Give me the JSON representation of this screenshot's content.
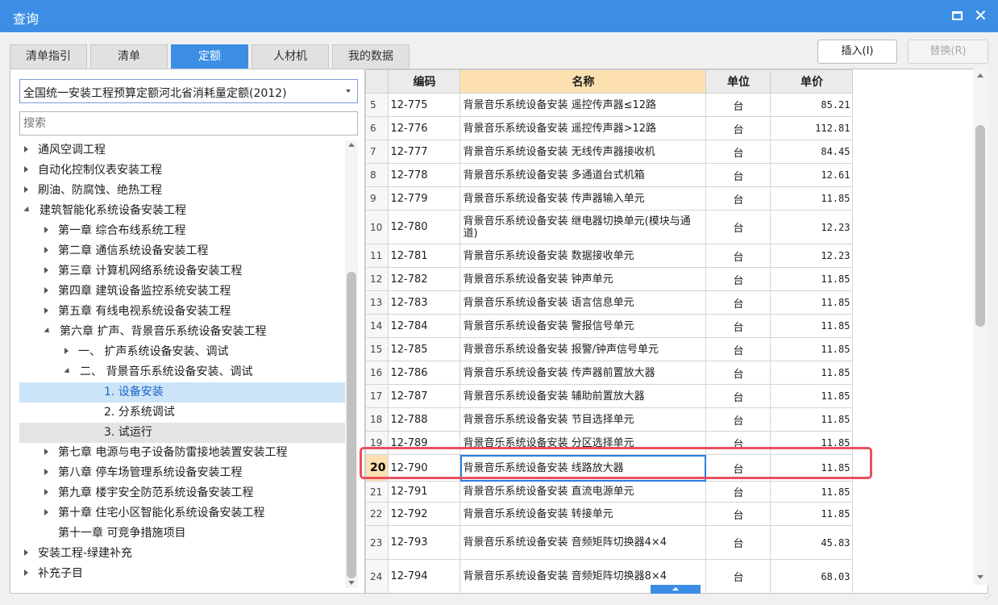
{
  "window": {
    "title": "查询"
  },
  "tabs": [
    "清单指引",
    "清单",
    "定额",
    "人材机",
    "我的数据"
  ],
  "buttons": {
    "insert": "插入(I)",
    "replace": "替换(R)"
  },
  "left": {
    "dropdown_value": "全国统一安装工程预算定额河北省消耗量定额(2012)",
    "search_placeholder": "搜索",
    "tree": [
      "通风空调工程",
      "自动化控制仪表安装工程",
      "刷油、防腐蚀、绝热工程",
      "建筑智能化系统设备安装工程",
      "第一章 综合布线系统工程",
      "第二章 通信系统设备安装工程",
      "第三章 计算机网络系统设备安装工程",
      "第四章 建筑设备监控系统安装工程",
      "第五章 有线电视系统设备安装工程",
      "第六章 扩声、背景音乐系统设备安装工程",
      "一、 扩声系统设备安装、调试",
      "二、 背景音乐系统设备安装、调试",
      "1. 设备安装",
      "2. 分系统调试",
      "3. 试运行",
      "第七章 电源与电子设备防雷接地装置安装工程",
      "第八章 停车场管理系统设备安装工程",
      "第九章 楼宇安全防范系统设备安装工程",
      "第十章 住宅小区智能化系统设备安装工程",
      "第十一章 可竞争措施项目",
      "安装工程-绿建补充",
      "补充子目"
    ]
  },
  "table": {
    "headers": [
      "编码",
      "名称",
      "单位",
      "单价"
    ],
    "rows": [
      {
        "n": "5",
        "code": "12-775",
        "name": "背景音乐系统设备安装 遥控传声器≤12路",
        "unit": "台",
        "price": "85.21"
      },
      {
        "n": "6",
        "code": "12-776",
        "name": "背景音乐系统设备安装 遥控传声器>12路",
        "unit": "台",
        "price": "112.81"
      },
      {
        "n": "7",
        "code": "12-777",
        "name": "背景音乐系统设备安装 无线传声器接收机",
        "unit": "台",
        "price": "84.45"
      },
      {
        "n": "8",
        "code": "12-778",
        "name": "背景音乐系统设备安装 多通道台式机箱",
        "unit": "台",
        "price": "12.61"
      },
      {
        "n": "9",
        "code": "12-779",
        "name": "背景音乐系统设备安装 传声器输入单元",
        "unit": "台",
        "price": "11.85"
      },
      {
        "n": "10",
        "code": "12-780",
        "name": "背景音乐系统设备安装 继电器切换单元(模块与通道)",
        "unit": "台",
        "price": "12.23"
      },
      {
        "n": "11",
        "code": "12-781",
        "name": "背景音乐系统设备安装 数据接收单元",
        "unit": "台",
        "price": "12.23"
      },
      {
        "n": "12",
        "code": "12-782",
        "name": "背景音乐系统设备安装 钟声单元",
        "unit": "台",
        "price": "11.85"
      },
      {
        "n": "13",
        "code": "12-783",
        "name": "背景音乐系统设备安装 语言信息单元",
        "unit": "台",
        "price": "11.85"
      },
      {
        "n": "14",
        "code": "12-784",
        "name": "背景音乐系统设备安装 警报信号单元",
        "unit": "台",
        "price": "11.85"
      },
      {
        "n": "15",
        "code": "12-785",
        "name": "背景音乐系统设备安装 报警/钟声信号单元",
        "unit": "台",
        "price": "11.85"
      },
      {
        "n": "16",
        "code": "12-786",
        "name": "背景音乐系统设备安装 传声器前置放大器",
        "unit": "台",
        "price": "11.85"
      },
      {
        "n": "17",
        "code": "12-787",
        "name": "背景音乐系统设备安装 辅助前置放大器",
        "unit": "台",
        "price": "11.85"
      },
      {
        "n": "18",
        "code": "12-788",
        "name": "背景音乐系统设备安装 节目选择单元",
        "unit": "台",
        "price": "11.85"
      },
      {
        "n": "19",
        "code": "12-789",
        "name": "背景音乐系统设备安装 分区选择单元",
        "unit": "台",
        "price": "11.85"
      },
      {
        "n": "20",
        "code": "12-790",
        "name": "背景音乐系统设备安装 线路放大器",
        "unit": "台",
        "price": "11.85"
      },
      {
        "n": "21",
        "code": "12-791",
        "name": "背景音乐系统设备安装 直流电源单元",
        "unit": "台",
        "price": "11.85"
      },
      {
        "n": "22",
        "code": "12-792",
        "name": "背景音乐系统设备安装 转接单元",
        "unit": "台",
        "price": "11.85"
      },
      {
        "n": "23",
        "code": "12-793",
        "name": "背景音乐系统设备安装 音频矩阵切换器4×4",
        "unit": "台",
        "price": "45.83"
      },
      {
        "n": "24",
        "code": "12-794",
        "name": "背景音乐系统设备安装 音频矩阵切换器8×4",
        "unit": "台",
        "price": "68.03"
      }
    ]
  }
}
